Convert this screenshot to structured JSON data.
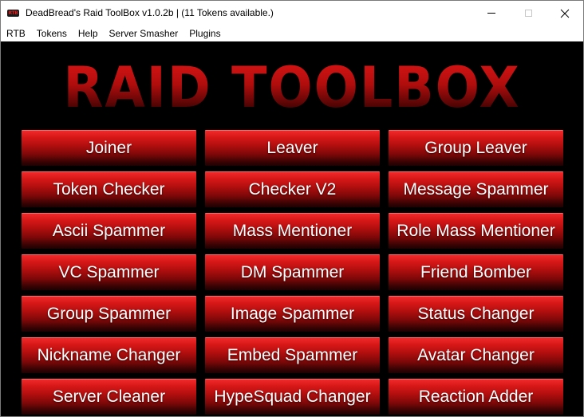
{
  "window": {
    "title": "DeadBread's Raid ToolBox v1.0.2b | (11 Tokens available.)",
    "icon_label": "RTB",
    "icon_name": "rtb-app-icon"
  },
  "menubar": {
    "items": [
      "RTB",
      "Tokens",
      "Help",
      "Server Smasher",
      "Plugins"
    ]
  },
  "logo": {
    "text": "RAID TOOLBOX"
  },
  "buttons": [
    "Joiner",
    "Leaver",
    "Group Leaver",
    "Token Checker",
    "Checker V2",
    "Message Spammer",
    "Ascii Spammer",
    "Mass Mentioner",
    "Role Mass Mentioner",
    "VC Spammer",
    "DM Spammer",
    "Friend Bomber",
    "Group Spammer",
    "Image Spammer",
    "Status Changer",
    "Nickname Changer",
    "Embed Spammer",
    "Avatar Changer",
    "Server Cleaner",
    "HypeSquad Changer",
    "Reaction Adder"
  ],
  "colors": {
    "accent": "#d81818",
    "background": "#000000",
    "button_text": "#ffffff"
  }
}
